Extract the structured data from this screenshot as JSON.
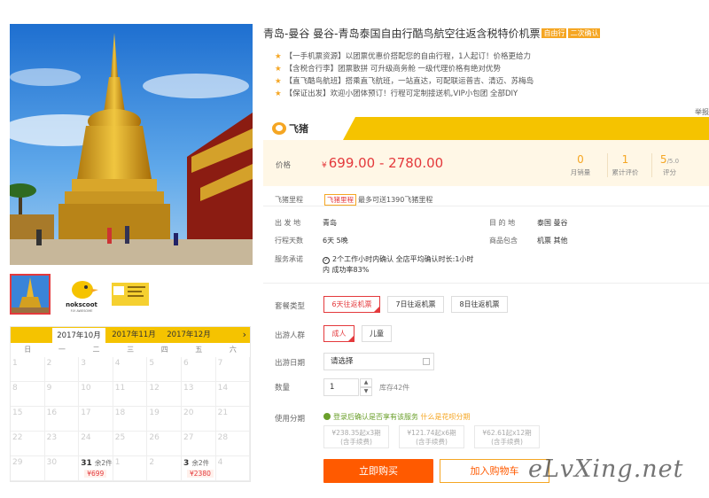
{
  "title": "青岛-曼谷 曼谷-青岛泰国自由行酷鸟航空往返含税特价机票",
  "tags": [
    "自由行",
    "二次确认"
  ],
  "highlights": [
    "【一手机票资源】以团票优惠价搭配您的自由行程，1人起订！价格更给力",
    "【含税合行李】团票散拼 可升级商务舱 一级代理价格有绝对优势",
    "【直飞酷鸟航班】搭乘直飞航班，一站直达，可配联运普吉、清迈、苏梅岛",
    "【保证出发】欢迎小团体预订！行程可定制接送机,VIP小包团 全部DIY"
  ],
  "report_label": "举报",
  "brand": "飞猪",
  "price": {
    "label": "价格",
    "currency": "¥",
    "range": "699.00 - 2780.00"
  },
  "stats": [
    {
      "value": "0",
      "label": "月销量"
    },
    {
      "value": "1",
      "label": "累计评价"
    },
    {
      "value": "5",
      "suffix": "/5.0",
      "label": "评分"
    }
  ],
  "mileage": {
    "label": "飞猪里程",
    "badge": "飞猪里程",
    "text": "最多可送1390飞猪里程"
  },
  "info": {
    "departure_label": "出 发 地",
    "departure": "青岛",
    "destination_label": "目 的 地",
    "destination": "泰国 曼谷",
    "days_label": "行程天数",
    "days": "6天  5晚",
    "includes_label": "商品包含",
    "includes": "机票  其他",
    "promise_label": "服务承诺",
    "promise_line1": "2个工作小时内确认 全店平均确认时长:1小时",
    "promise_line2": "内 成功率83%"
  },
  "options": {
    "package_label": "套餐类型",
    "packages": [
      "6天往返机票",
      "7日往返机票",
      "8日往返机票"
    ],
    "people_label": "出游人群",
    "people": [
      "成人",
      "儿童"
    ],
    "date_label": "出游日期",
    "date_placeholder": "请选择",
    "qty_label": "数量",
    "qty_value": "1",
    "stock": "库存42件",
    "installment_label": "使用分期",
    "installment_hint": "登录后确认是否享有该服务",
    "installment_link": "什么是花呗分期",
    "installments": [
      {
        "amount": "¥238.35起x3期",
        "fee": "(含手续费)"
      },
      {
        "amount": "¥121.74起x6期",
        "fee": "(含手续费)"
      },
      {
        "amount": "¥62.61起x12期",
        "fee": "(含手续费)"
      }
    ]
  },
  "buttons": {
    "buy": "立即购买",
    "cart": "加入购物车"
  },
  "calendar": {
    "months": [
      "2017年10月",
      "2017年11月",
      "2017年12月"
    ],
    "next": "›",
    "weekdays": [
      "日",
      "一",
      "二",
      "三",
      "四",
      "五",
      "六"
    ],
    "week1": [
      "1",
      "2",
      "3",
      "4",
      "5",
      "6",
      "7"
    ],
    "week2": [
      "8",
      "9",
      "10",
      "11",
      "12",
      "13",
      "14"
    ],
    "week3": [
      "15",
      "16",
      "17",
      "18",
      "19",
      "20",
      "21"
    ],
    "week4": [
      "22",
      "23",
      "24",
      "25",
      "26",
      "27",
      "28"
    ],
    "week5_plain": [
      "29",
      "30"
    ],
    "day31": "31",
    "day31_left": "余2件",
    "day31_price": "¥699",
    "next1": "1",
    "next2": "2",
    "day3": "3",
    "day3_left": "余2件",
    "day3_price": "¥2380",
    "next4": "4"
  },
  "thumb_logo_text": "nokscoot",
  "thumb_logo_sub": "FLY AWESOME",
  "watermark": "eLvXing.net",
  "colors": {
    "accent": "#f5c300",
    "price": "#e4393c",
    "buy": "#ff5a00"
  }
}
